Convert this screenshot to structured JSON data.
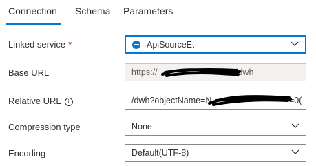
{
  "tabs": [
    {
      "label": "Connection",
      "active": true
    },
    {
      "label": "Schema"
    },
    {
      "label": "Parameters"
    }
  ],
  "form": {
    "linked_service": {
      "label": "Linked service",
      "required_mark": "*",
      "value": "ApiSourceEt"
    },
    "base_url": {
      "label": "Base URL",
      "value": "https://",
      "value_suffix": "/dwh"
    },
    "relative_url": {
      "label": "Relative URL",
      "info_icon": "ⓘ",
      "value": "/dwh?objectName=N",
      "value_suffix": "=0("
    },
    "compression_type": {
      "label": "Compression type",
      "value": "None"
    },
    "encoding": {
      "label": "Encoding",
      "value": "Default(UTF-8)"
    }
  },
  "colors": {
    "accent": "#0078d4",
    "required": "#a4262c",
    "readonly_bg": "#f3f2f1"
  }
}
